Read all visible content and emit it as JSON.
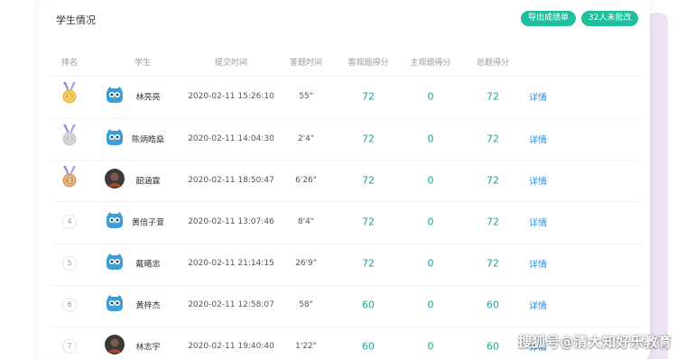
{
  "header": {
    "title": "学生情况",
    "export_button": "导出成绩单",
    "unmarked_button": "32人未批改"
  },
  "columns": [
    "排名",
    "学生",
    "提交时间",
    "答题时间",
    "客观题得分",
    "主观题得分",
    "总题得分"
  ],
  "rows": [
    {
      "rank": "1",
      "medal": "gold",
      "avatar": "owl",
      "name": "林亮亮",
      "submit_time": "2020-02-11 15:26:10",
      "duration": "55\"",
      "objective": "72",
      "subjective": "0",
      "total": "72",
      "action": "详情"
    },
    {
      "rank": "2",
      "medal": "silver",
      "avatar": "owl",
      "name": "陈炳皓燊",
      "submit_time": "2020-02-11 14:04:30",
      "duration": "2'4\"",
      "objective": "72",
      "subjective": "0",
      "total": "72",
      "action": "详情"
    },
    {
      "rank": "3",
      "medal": "bronze",
      "avatar": "photo",
      "name": "韶涵霆",
      "submit_time": "2020-02-11 18:50:47",
      "duration": "6'26\"",
      "objective": "72",
      "subjective": "0",
      "total": "72",
      "action": "详情"
    },
    {
      "rank": "4",
      "medal": "",
      "avatar": "owl",
      "name": "黄倍子萱",
      "submit_time": "2020-02-11 13:07:46",
      "duration": "8'4\"",
      "objective": "72",
      "subjective": "0",
      "total": "72",
      "action": "详情"
    },
    {
      "rank": "5",
      "medal": "",
      "avatar": "owl",
      "name": "戴曦忠",
      "submit_time": "2020-02-11 21:14:15",
      "duration": "26'9\"",
      "objective": "72",
      "subjective": "0",
      "total": "72",
      "action": "详情"
    },
    {
      "rank": "6",
      "medal": "",
      "avatar": "owl",
      "name": "黄梓杰",
      "submit_time": "2020-02-11 12:58:07",
      "duration": "58\"",
      "objective": "60",
      "subjective": "0",
      "total": "60",
      "action": "详情"
    },
    {
      "rank": "7",
      "medal": "",
      "avatar": "photo",
      "name": "林志宇",
      "submit_time": "2020-02-11 19:40:40",
      "duration": "1'22\"",
      "objective": "60",
      "subjective": "0",
      "total": "60",
      "action": "详情"
    }
  ],
  "watermark": "搜狐号@清大知好乐教育",
  "colors": {
    "accent": "#1fbf9d",
    "score": "#1fa39a",
    "link": "#3a8fd6",
    "gold": "#e8b93a",
    "silver": "#c8c8c8",
    "bronze": "#d39a5c",
    "owl": "#3b9ed8"
  }
}
